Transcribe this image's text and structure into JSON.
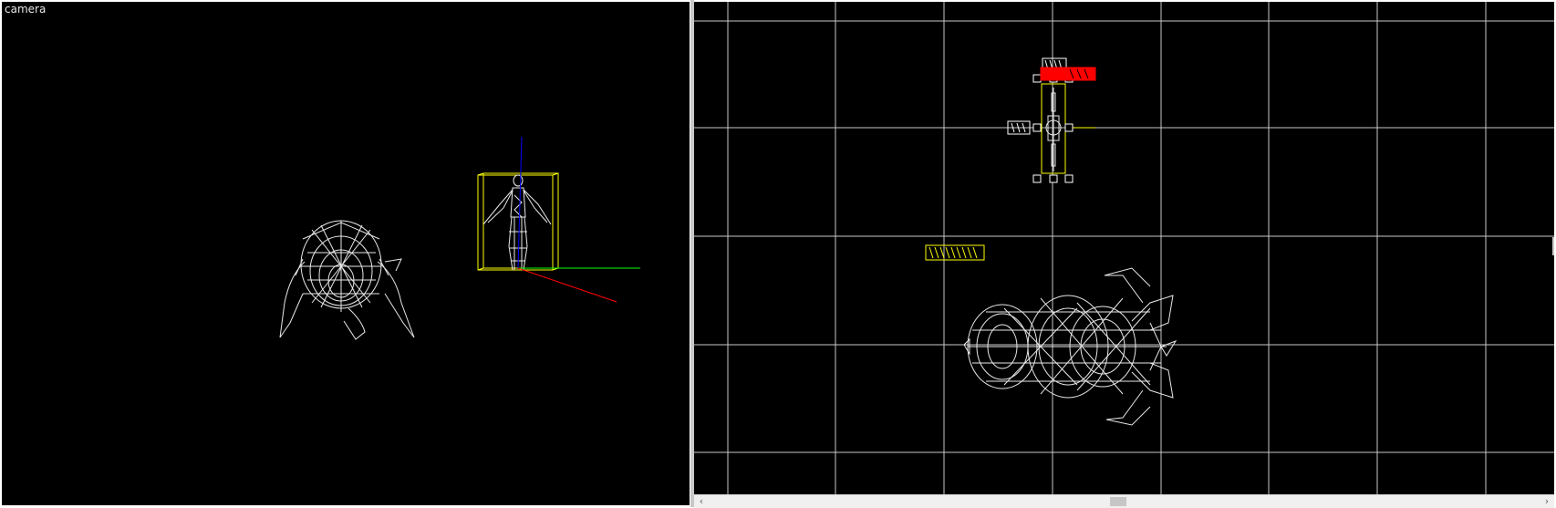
{
  "camera_viewport": {
    "label": "camera"
  },
  "top_viewport": {
    "entity_labels": [
      "",
      "",
      "",
      ""
    ]
  },
  "colors": {
    "background": "#000000",
    "wireframe": "#e8e8e8",
    "selection": "#ffff00",
    "grid": "#c8c8c8",
    "axis_x": "#ff0000",
    "axis_y": "#00ff00",
    "axis_z": "#0000ff",
    "selected_tag": "#ff0000"
  },
  "icons": {
    "scroll_left": "chevron-left-icon",
    "scroll_right": "chevron-right-icon"
  }
}
